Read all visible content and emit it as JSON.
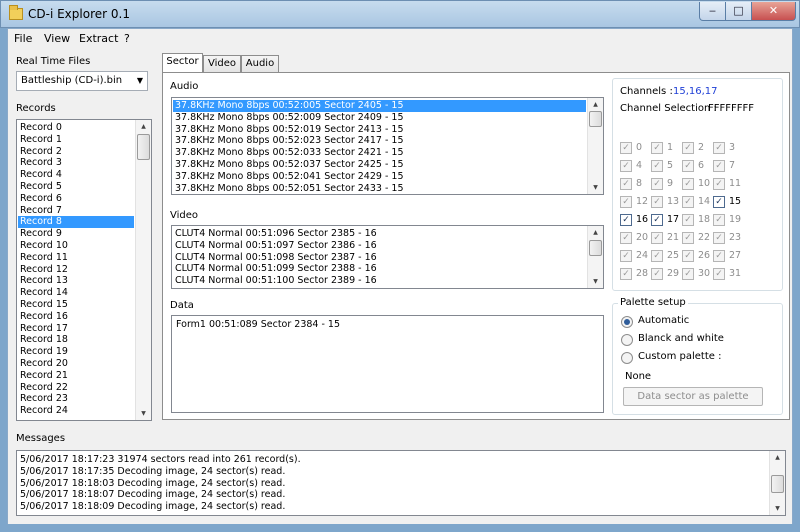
{
  "window": {
    "title": "CD-i Explorer 0.1",
    "min_glyph": "‒",
    "max_glyph": "□",
    "close_glyph": "✕"
  },
  "menu": {
    "file": "File",
    "view": "View",
    "extract": "Extract",
    "help": "?"
  },
  "left": {
    "files_label": "Real Time Files",
    "file_selected": "Battleship (CD-i).bin",
    "records_label": "Records",
    "records": [
      "Record 0",
      "Record 1",
      "Record 2",
      "Record 3",
      "Record 4",
      "Record 5",
      "Record 6",
      "Record 7",
      "Record 8",
      "Record 9",
      "Record 10",
      "Record 11",
      "Record 12",
      "Record 13",
      "Record 14",
      "Record 15",
      "Record 16",
      "Record 17",
      "Record 18",
      "Record 19",
      "Record 20",
      "Record 21",
      "Record 22",
      "Record 23",
      "Record 24"
    ],
    "selected_record": 8
  },
  "tabs": [
    "Sector",
    "Video",
    "Audio"
  ],
  "sector": {
    "audio_label": "Audio",
    "audio": [
      "37.8KHz Mono 8bps 00:52:005  Sector 2405 - 15",
      "37.8KHz Mono 8bps 00:52:009  Sector 2409 - 15",
      "37.8KHz Mono 8bps 00:52:019  Sector 2413 - 15",
      "37.8KHz Mono 8bps 00:52:023  Sector 2417 - 15",
      "37.8KHz Mono 8bps 00:52:033  Sector 2421 - 15",
      "37.8KHz Mono 8bps 00:52:037  Sector 2425 - 15",
      "37.8KHz Mono 8bps 00:52:041  Sector 2429 - 15",
      "37.8KHz Mono 8bps 00:52:051  Sector 2433 - 15"
    ],
    "video_label": "Video",
    "video": [
      "CLUT4 Normal 00:51:096  Sector 2385 - 16",
      "CLUT4 Normal 00:51:097  Sector 2386 - 16",
      "CLUT4 Normal 00:51:098  Sector 2387 - 16",
      "CLUT4 Normal 00:51:099  Sector 2388 - 16",
      "CLUT4 Normal 00:51:100  Sector 2389 - 16"
    ],
    "data_label": "Data",
    "data": [
      "Form1 00:51:089  Sector 2384 - 15"
    ]
  },
  "channels": {
    "label": "Channels :",
    "value": "15,16,17",
    "selection_label": "Channel Selection :",
    "selection_value": "FFFFFFFF",
    "items": [
      "0",
      "1",
      "2",
      "3",
      "4",
      "5",
      "6",
      "7",
      "8",
      "9",
      "10",
      "11",
      "12",
      "13",
      "14",
      "15",
      "16",
      "17",
      "18",
      "19",
      "20",
      "21",
      "22",
      "23",
      "24",
      "25",
      "26",
      "27",
      "28",
      "29",
      "30",
      "31"
    ],
    "checked": [
      15,
      16,
      17
    ],
    "check_glyph": "✓"
  },
  "palette": {
    "title": "Palette setup",
    "options": [
      "Automatic",
      "Blanck and white",
      "Custom palette :"
    ],
    "selected": 0,
    "custom_value": "None",
    "button": "Data sector as palette"
  },
  "messages": {
    "label": "Messages",
    "lines": [
      "5/06/2017 18:17:23 31974 sectors read into 261 record(s).",
      "5/06/2017 18:17:35 Decoding image, 24 sector(s) read.",
      "5/06/2017 18:18:03 Decoding image, 24 sector(s) read.",
      "5/06/2017 18:18:07 Decoding image, 24 sector(s) read.",
      "5/06/2017 18:18:09 Decoding image, 24 sector(s) read."
    ]
  },
  "glyphs": {
    "up": "▲",
    "down": "▼",
    "combo": "▼"
  }
}
